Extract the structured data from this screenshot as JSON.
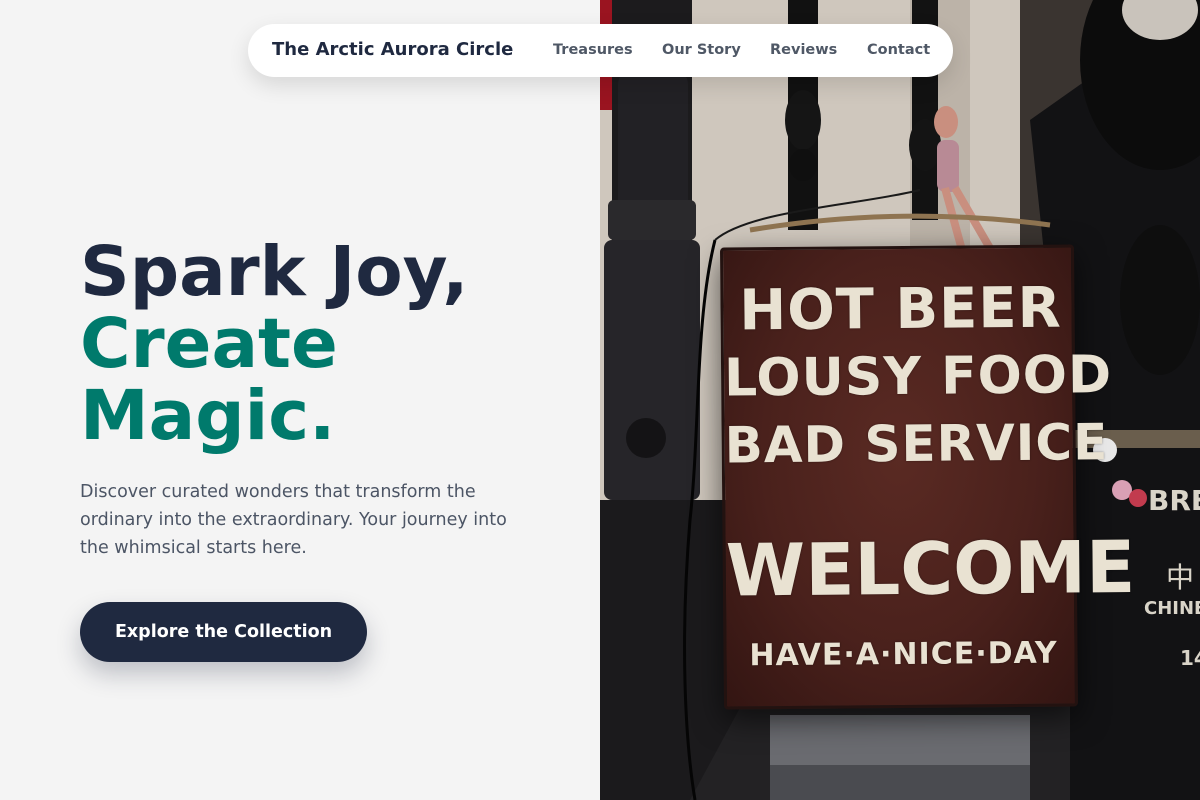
{
  "nav": {
    "brand": "The Arctic Aurora Circle",
    "links": [
      "Treasures",
      "Our Story",
      "Reviews",
      "Contact"
    ]
  },
  "hero": {
    "headline_line1": "Spark Joy,",
    "headline_line2": "Create",
    "headline_line3": "Magic.",
    "description": "Discover curated wonders that transform the ordinary into the extraordinary. Your journey into the whimsical starts here.",
    "cta_label": "Explore the Collection"
  },
  "photo": {
    "sign_line1": "HOT BEER",
    "sign_line2": "LOUSY FOOD",
    "sign_line3": "BAD SERVICE",
    "sign_line4": "WELCOME",
    "sign_line5": "HAVE·A·NICE·DAY",
    "side_text1": "BRE",
    "side_text2": "中",
    "side_text3": "CHINE",
    "side_text4": "14"
  },
  "colors": {
    "navy": "#1f2940",
    "teal": "#007a6c",
    "background": "#f4f4f4"
  }
}
